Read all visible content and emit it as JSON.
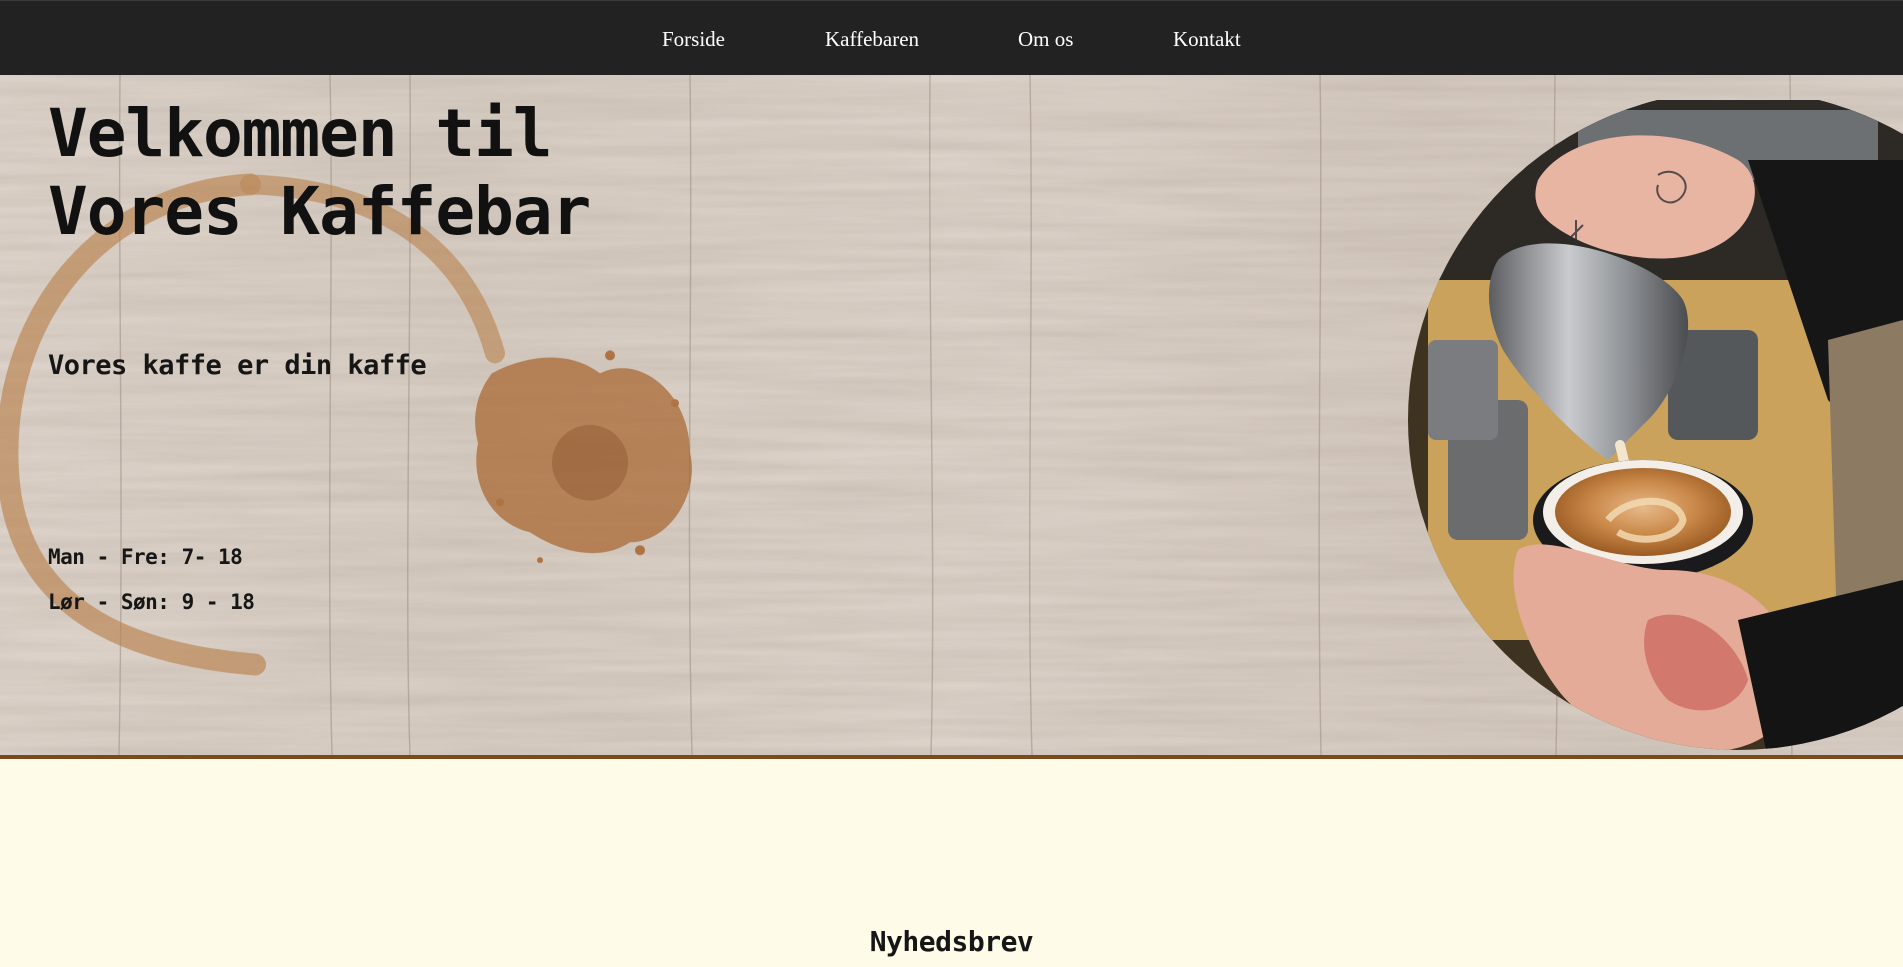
{
  "nav": {
    "items": [
      {
        "label": "Forside"
      },
      {
        "label": "Kaffebaren"
      },
      {
        "label": "Om os"
      },
      {
        "label": "Kontakt"
      }
    ]
  },
  "hero": {
    "title_line1": "Velkommen til",
    "title_line2": "Vores Kaffebar",
    "tagline": "Vores kaffe er din kaffe",
    "hours": [
      {
        "text": "Man - Fre: 7- 18"
      },
      {
        "text": "Lør - Søn: 9 - 18"
      }
    ]
  },
  "newsletter": {
    "title": "Nyhedsbrev"
  },
  "colors": {
    "nav_bg": "#222222",
    "page_bg": "#fefbe8",
    "hero_border": "#7a4a1a",
    "coffee_stain": "#b0743f"
  },
  "icons": {
    "coffee_photo": "latte-art-pour-image",
    "stain": "coffee-stain-decoration"
  }
}
